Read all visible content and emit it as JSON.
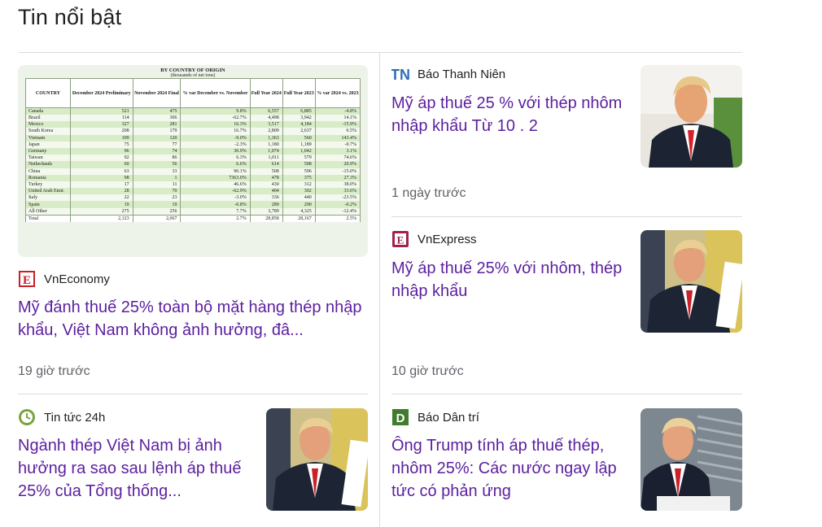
{
  "section_title": "Tin nổi bật",
  "colors": {
    "title_link": "#5b1f9e",
    "source_text": "#202124",
    "time_text": "#5f6368",
    "divider": "#dadce0"
  },
  "cards": [
    {
      "source": "VnEconomy",
      "logo_icon": "vneconomy-logo-icon",
      "title": "Mỹ đánh thuế 25% toàn bộ mặt hàng thép nhập khẩu, Việt Nam không ảnh hưởng, đâ...",
      "time": "19 giờ trước",
      "image": "steel-import-table-image"
    },
    {
      "source": "Báo Thanh Niên",
      "logo_icon": "thanhnien-logo-icon",
      "title": "Mỹ áp thuế 25 % với thép nhôm nhập khẩu Từ 10 . 2",
      "time": "1 ngày trước",
      "image": "trump-portrait-image"
    },
    {
      "source": "VnExpress",
      "logo_icon": "vnexpress-logo-icon",
      "title": "Mỹ áp thuế 25% với nhôm, thép nhập khẩu",
      "time": "10 giờ trước",
      "image": "trump-signing-image"
    },
    {
      "source": "Tin tức 24h",
      "logo_icon": "24h-logo-icon",
      "title": "Ngành thép Việt Nam bị ảnh hưởng ra sao sau lệnh áp thuế 25% của Tổng thống...",
      "time": "",
      "image": "trump-signing-image"
    },
    {
      "source": "Báo Dân trí",
      "logo_icon": "dantri-logo-icon",
      "title": "Ông Trump tính áp thuế thép, nhôm 25%: Các nước ngay lập tức có phản ứng",
      "time": "",
      "image": "trump-steel-image"
    }
  ],
  "steel_table": {
    "caption": "BY COUNTRY OF ORIGIN",
    "subcaption": "(thousands of net tons)",
    "headers": [
      "COUNTRY",
      "December 2024 Preliminary",
      "November 2024 Final",
      "% var December vs. November",
      "Full Year 2024",
      "Full Year 2023",
      "% var 2024 vs. 2023"
    ],
    "rows": [
      [
        "Canada",
        "521",
        "475",
        "9.8%",
        "6,557",
        "6,885",
        "-4.8%"
      ],
      [
        "Brazil",
        "114",
        "306",
        "-62.7%",
        "4,498",
        "3,942",
        "14.1%"
      ],
      [
        "Mexico",
        "327",
        "281",
        "16.3%",
        "3,517",
        "4,184",
        "-15.9%"
      ],
      [
        "South Korea",
        "208",
        "179",
        "16.7%",
        "2,809",
        "2,637",
        "6.5%"
      ],
      [
        "Vietnam",
        "109",
        "120",
        "-9.0%",
        "1,363",
        "560",
        "143.4%"
      ],
      [
        "Japan",
        "75",
        "77",
        "-2.3%",
        "1,180",
        "1,189",
        "-0.7%"
      ],
      [
        "Germany",
        "96",
        "74",
        "30.9%",
        "1,074",
        "1,042",
        "3.1%"
      ],
      [
        "Taiwan",
        "92",
        "86",
        "6.3%",
        "1,011",
        "579",
        "74.6%"
      ],
      [
        "Netherlands",
        "60",
        "56",
        "6.6%",
        "614",
        "508",
        "20.9%"
      ],
      [
        "China",
        "63",
        "33",
        "90.1%",
        "508",
        "596",
        "-15.0%"
      ],
      [
        "Romania",
        "98",
        "1",
        "7363.0%",
        "478",
        "375",
        "27.3%"
      ],
      [
        "Turkey",
        "17",
        "11",
        "46.6%",
        "430",
        "312",
        "38.0%"
      ],
      [
        "United Arab Emir.",
        "28",
        "70",
        "-62.9%",
        "404",
        "302",
        "33.6%"
      ],
      [
        "Italy",
        "22",
        "23",
        "-3.0%",
        "336",
        "440",
        "-23.5%"
      ],
      [
        "Spain",
        "19",
        "19",
        "-0.8%",
        "289",
        "290",
        "-0.2%"
      ],
      [
        "All Other",
        "275",
        "256",
        "7.7%",
        "3,789",
        "4,325",
        "-12.4%"
      ],
      [
        "Total",
        "2,123",
        "2,067",
        "2.7%",
        "28,858",
        "28,167",
        "2.5%"
      ]
    ]
  }
}
